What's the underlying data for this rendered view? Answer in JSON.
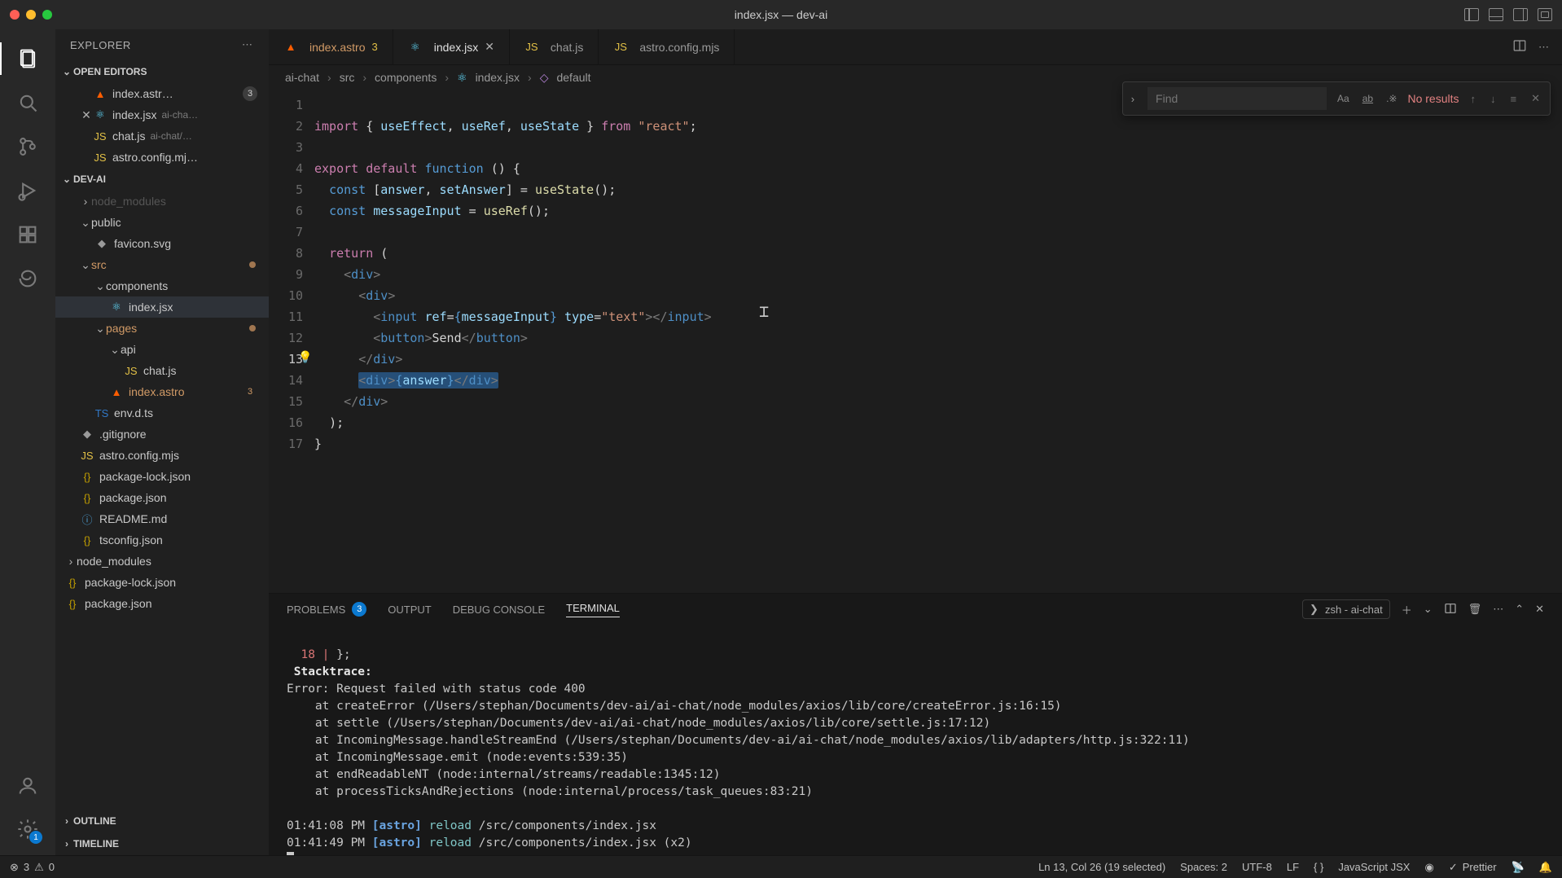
{
  "title": "index.jsx — dev-ai",
  "sidebar": {
    "title": "EXPLORER",
    "sections": {
      "open_editors": "OPEN EDITORS",
      "project": "DEV-AI",
      "outline": "OUTLINE",
      "timeline": "TIMELINE"
    },
    "open_editors": [
      {
        "name": "index.astr…",
        "badge": "3"
      },
      {
        "name": "index.jsx",
        "meta": "ai-cha…"
      },
      {
        "name": "chat.js",
        "meta": "ai-chat/…"
      },
      {
        "name": "astro.config.mj…"
      }
    ],
    "tree": {
      "node_modules_ghost": "node_modules",
      "public": "public",
      "favicon": "favicon.svg",
      "src": "src",
      "components": "components",
      "index_jsx": "index.jsx",
      "pages": "pages",
      "api": "api",
      "chat_js": "chat.js",
      "index_astro": "index.astro",
      "index_astro_badge": "3",
      "env_d_ts": "env.d.ts",
      "gitignore": ".gitignore",
      "astro_config": "astro.config.mjs",
      "pkg_lock": "package-lock.json",
      "pkg": "package.json",
      "readme": "README.md",
      "tsconfig": "tsconfig.json",
      "node_modules": "node_modules",
      "pkg_lock2": "package-lock.json",
      "pkg2": "package.json"
    }
  },
  "tabs": [
    {
      "label": "index.astro",
      "badge": "3"
    },
    {
      "label": "index.jsx"
    },
    {
      "label": "chat.js"
    },
    {
      "label": "astro.config.mjs"
    }
  ],
  "breadcrumb": [
    "ai-chat",
    "src",
    "components",
    "index.jsx",
    "default"
  ],
  "code": {
    "lines": [
      "1",
      "2",
      "3",
      "4",
      "5",
      "6",
      "7",
      "8",
      "9",
      "10",
      "11",
      "12",
      "13",
      "14",
      "15",
      "16",
      "17"
    ],
    "l1_import": "import",
    "l1_useEffect": "useEffect",
    "l1_useRef": "useRef",
    "l1_useState": "useState",
    "l1_from": "from",
    "l1_react": "\"react\"",
    "l3_export": "export",
    "l3_default": "default",
    "l3_function": "function",
    "l4_const": "const",
    "l4_answer": "answer",
    "l4_setAnswer": "setAnswer",
    "l4_useState": "useState",
    "l5_const": "const",
    "l5_messageInput": "messageInput",
    "l5_useRef": "useRef",
    "l7_return": "return",
    "l8_div": "div",
    "l9_div": "div",
    "l10_input": "input",
    "l10_ref": "ref",
    "l10_messageInput": "messageInput",
    "l10_type": "type",
    "l10_text": "\"text\"",
    "l10_cinput": "input",
    "l11_button": "button",
    "l11_send": "Send",
    "l11_cbutton": "button",
    "l12_cdiv": "div",
    "l13_div": "div",
    "l13_answer": "answer",
    "l13_cdiv": "div",
    "l14_cdiv": "div"
  },
  "find": {
    "placeholder": "Find",
    "no_results": "No results",
    "aa": "Aa",
    "ab": "ab"
  },
  "panel": {
    "tabs": {
      "problems": "PROBLEMS",
      "problems_badge": "3",
      "output": "OUTPUT",
      "debug": "DEBUG CONSOLE",
      "terminal": "TERMINAL"
    },
    "term_sel": "zsh - ai-chat",
    "body": {
      "l0a": "  18 | ",
      "l0b": "};",
      "l1": " Stacktrace:",
      "l2": "Error: Request failed with status code 400",
      "l3": "    at createError (/Users/stephan/Documents/dev-ai/ai-chat/node_modules/axios/lib/core/createError.js:16:15)",
      "l4": "    at settle (/Users/stephan/Documents/dev-ai/ai-chat/node_modules/axios/lib/core/settle.js:17:12)",
      "l5": "    at IncomingMessage.handleStreamEnd (/Users/stephan/Documents/dev-ai/ai-chat/node_modules/axios/lib/adapters/http.js:322:11)",
      "l6": "    at IncomingMessage.emit (node:events:539:35)",
      "l7": "    at endReadableNT (node:internal/streams/readable:1345:12)",
      "l8": "    at processTicksAndRejections (node:internal/process/task_queues:83:21)",
      "l9t": "01:41:08 PM ",
      "l9b": "[astro]",
      "l9r": " reload",
      "l9p": " /src/components/index.jsx",
      "l10t": "01:41:49 PM ",
      "l10b": "[astro]",
      "l10r": " reload",
      "l10p": " /src/components/index.jsx (x2)"
    }
  },
  "status": {
    "errors": "3",
    "warnings": "0",
    "sel": "Ln 13, Col 26 (19 selected)",
    "spaces": "Spaces: 2",
    "enc": "UTF-8",
    "eol": "LF",
    "lang": "JavaScript JSX",
    "prettier": "Prettier"
  },
  "activity_badge": "1"
}
